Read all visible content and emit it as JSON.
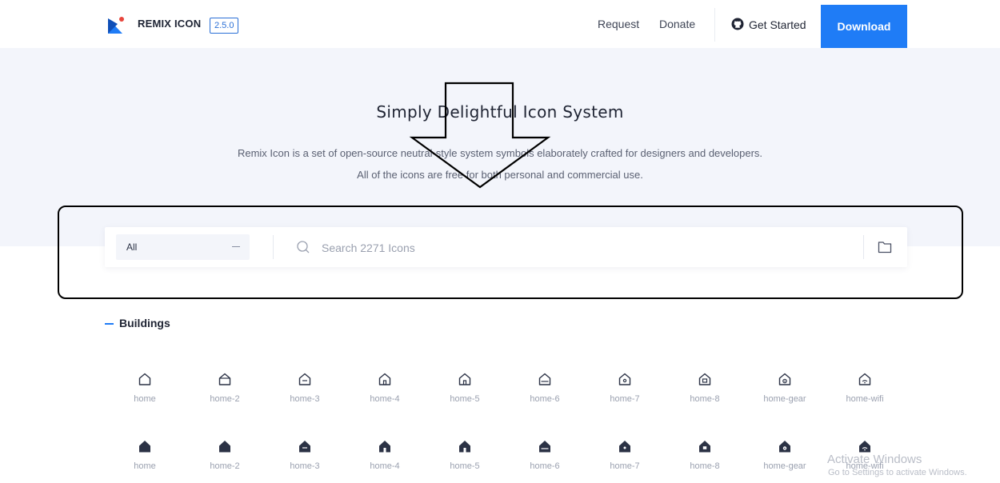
{
  "header": {
    "brand": "REMIX ICON",
    "version": "2.5.0",
    "nav": {
      "request": "Request",
      "donate": "Donate"
    },
    "get_started": "Get Started",
    "download": "Download",
    "colors": {
      "accent": "#1f7cf6",
      "logo_red": "#e8453c"
    }
  },
  "hero": {
    "title": "Simply Delightful Icon System",
    "description_line1": "Remix Icon is a set of open-source neutral-style system symbols elaborately crafted for designers and developers.",
    "description_line2": "All of the icons are free for both personal and commercial use."
  },
  "search": {
    "category_selected": "All",
    "placeholder": "Search 2271 Icons"
  },
  "section": {
    "title": "Buildings",
    "line_icons": [
      {
        "label": "home",
        "icon": "home-line-icon"
      },
      {
        "label": "home-2",
        "icon": "home-2-line-icon"
      },
      {
        "label": "home-3",
        "icon": "home-3-line-icon"
      },
      {
        "label": "home-4",
        "icon": "home-4-line-icon"
      },
      {
        "label": "home-5",
        "icon": "home-5-line-icon"
      },
      {
        "label": "home-6",
        "icon": "home-6-line-icon"
      },
      {
        "label": "home-7",
        "icon": "home-7-line-icon"
      },
      {
        "label": "home-8",
        "icon": "home-8-line-icon"
      },
      {
        "label": "home-gear",
        "icon": "home-gear-line-icon"
      },
      {
        "label": "home-wifi",
        "icon": "home-wifi-line-icon"
      }
    ],
    "fill_icons": [
      {
        "label": "home",
        "icon": "home-fill-icon"
      },
      {
        "label": "home-2",
        "icon": "home-2-fill-icon"
      },
      {
        "label": "home-3",
        "icon": "home-3-fill-icon"
      },
      {
        "label": "home-4",
        "icon": "home-4-fill-icon"
      },
      {
        "label": "home-5",
        "icon": "home-5-fill-icon"
      },
      {
        "label": "home-6",
        "icon": "home-6-fill-icon"
      },
      {
        "label": "home-7",
        "icon": "home-7-fill-icon"
      },
      {
        "label": "home-8",
        "icon": "home-8-fill-icon"
      },
      {
        "label": "home-gear",
        "icon": "home-gear-fill-icon"
      },
      {
        "label": "home-wifi",
        "icon": "home-wifi-fill-icon"
      }
    ]
  },
  "watermark": {
    "line1": "Activate Windows",
    "line2": "Go to Settings to activate Windows."
  }
}
